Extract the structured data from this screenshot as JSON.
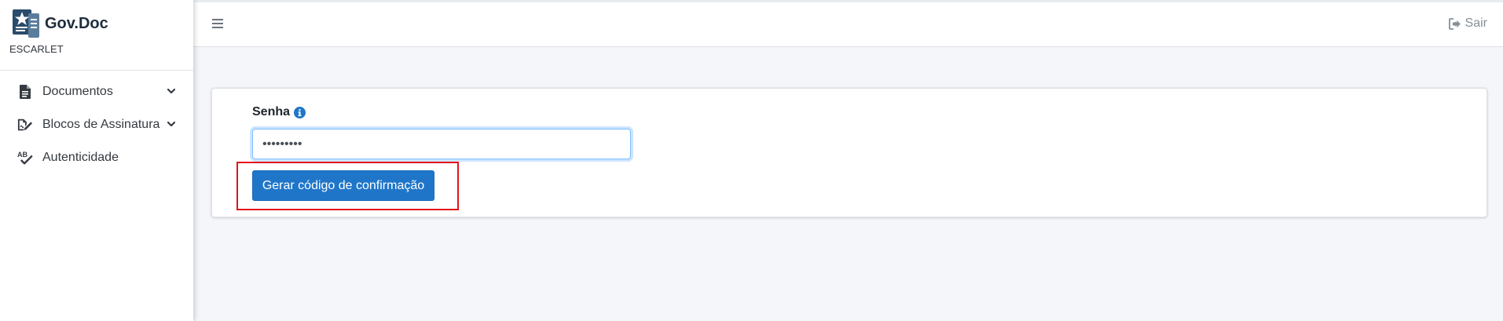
{
  "brand": {
    "title": "Gov.Doc",
    "subtitle": "ESCARLET"
  },
  "sidebar": {
    "items": [
      {
        "label": "Documentos",
        "icon": "file-document-icon",
        "has_chevron": true
      },
      {
        "label": "Blocos de Assinatura",
        "icon": "signature-icon",
        "has_chevron": true
      },
      {
        "label": "Autenticidade",
        "icon": "spell-check-icon",
        "has_chevron": false
      }
    ]
  },
  "topbar": {
    "menu_icon": "hamburger-icon",
    "logout_label": "Sair",
    "logout_icon": "sign-out-icon"
  },
  "form": {
    "password_label": "Senha",
    "password_value": "•••••••••",
    "submit_label": "Gerar código de confirmação"
  },
  "colors": {
    "primary": "#1f76c9",
    "highlight": "#e3131b",
    "info": "#1f76c9",
    "background": "#f4f6f9"
  }
}
